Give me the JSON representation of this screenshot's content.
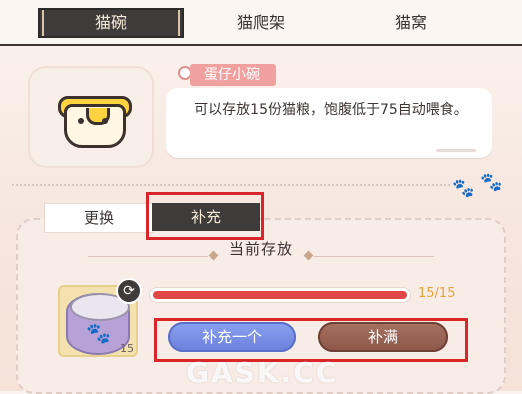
{
  "tabs": [
    {
      "label": "猫碗",
      "active": true
    },
    {
      "label": "猫爬架",
      "active": false
    },
    {
      "label": "猫窝",
      "active": false
    }
  ],
  "item": {
    "name": "蛋仔小碗",
    "description": "可以存放15份猫粮，饱腹低于75自动喂食。",
    "icon": "egg-bowl-icon"
  },
  "subtabs": {
    "replace_label": "更换",
    "refill_label": "补充",
    "active": "补充"
  },
  "storage": {
    "title": "当前存放",
    "current": 15,
    "max": 15,
    "text": "15/15",
    "fill_fraction": 1.0,
    "food_count": "15"
  },
  "buttons": {
    "add_one_label": "补充一个",
    "fill_label": "补满"
  },
  "watermark": "GASK.CC",
  "colors": {
    "active_tab_bg": "#3f3b3b",
    "bar_fill": "#e24747",
    "add_one_btn": "#7a90e6",
    "fill_btn": "#9a6354",
    "highlight": "#d8262b",
    "name_tag": "#f1a0a0"
  }
}
